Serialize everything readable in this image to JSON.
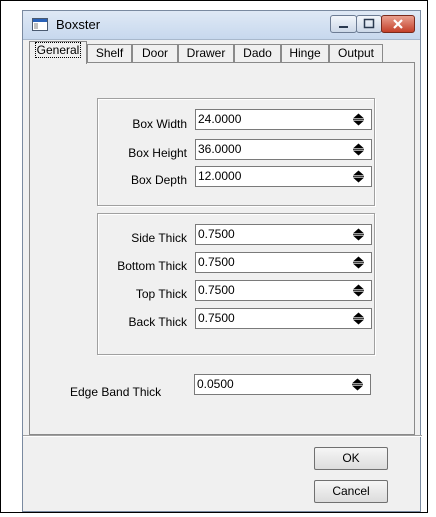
{
  "window": {
    "title": "Boxster"
  },
  "tabs": [
    "General",
    "Shelf",
    "Door",
    "Drawer",
    "Dado",
    "Hinge",
    "Output"
  ],
  "dimensions": {
    "box_width": {
      "label": "Box Width",
      "value": "24.0000"
    },
    "box_height": {
      "label": "Box Height",
      "value": "36.0000"
    },
    "box_depth": {
      "label": "Box Depth",
      "value": "12.0000"
    }
  },
  "thickness": {
    "side": {
      "label": "Side Thick",
      "value": "0.7500"
    },
    "bottom": {
      "label": "Bottom Thick",
      "value": "0.7500"
    },
    "top": {
      "label": "Top Thick",
      "value": "0.7500"
    },
    "back": {
      "label": "Back Thick",
      "value": "0.7500"
    }
  },
  "edge_band": {
    "label": "Edge Band Thick",
    "value": "0.0500"
  },
  "buttons": {
    "ok": "OK",
    "cancel": "Cancel"
  },
  "colors": {
    "title_accent": "#2a62b8",
    "close_red": "#c4402a"
  }
}
